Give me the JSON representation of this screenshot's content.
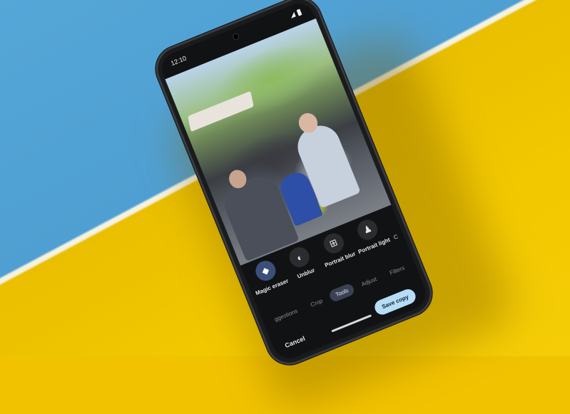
{
  "status_bar": {
    "time": "12:10"
  },
  "editor": {
    "tools": [
      {
        "label": "Magic eraser",
        "icon": "eraser-icon",
        "active": true
      },
      {
        "label": "Unblur",
        "icon": "unblur-icon",
        "active": false
      },
      {
        "label": "Portrait blur",
        "icon": "portrait-blur-icon",
        "active": false
      },
      {
        "label": "Portrait light",
        "icon": "portrait-light-icon",
        "active": false
      },
      {
        "label": "C",
        "icon": "",
        "active": false
      }
    ],
    "tabs": [
      {
        "label": "ggestions",
        "active": false
      },
      {
        "label": "Crop",
        "active": false
      },
      {
        "label": "Tools",
        "active": true
      },
      {
        "label": "Adjust",
        "active": false
      },
      {
        "label": "Filters",
        "active": false
      }
    ],
    "save_label": "Save copy",
    "cancel_label": "Cancel"
  },
  "colors": {
    "background_blue": "#4f9fd2",
    "background_yellow": "#f2c800",
    "accent_save": "#b7dcf6",
    "active_tab": "#394152"
  }
}
